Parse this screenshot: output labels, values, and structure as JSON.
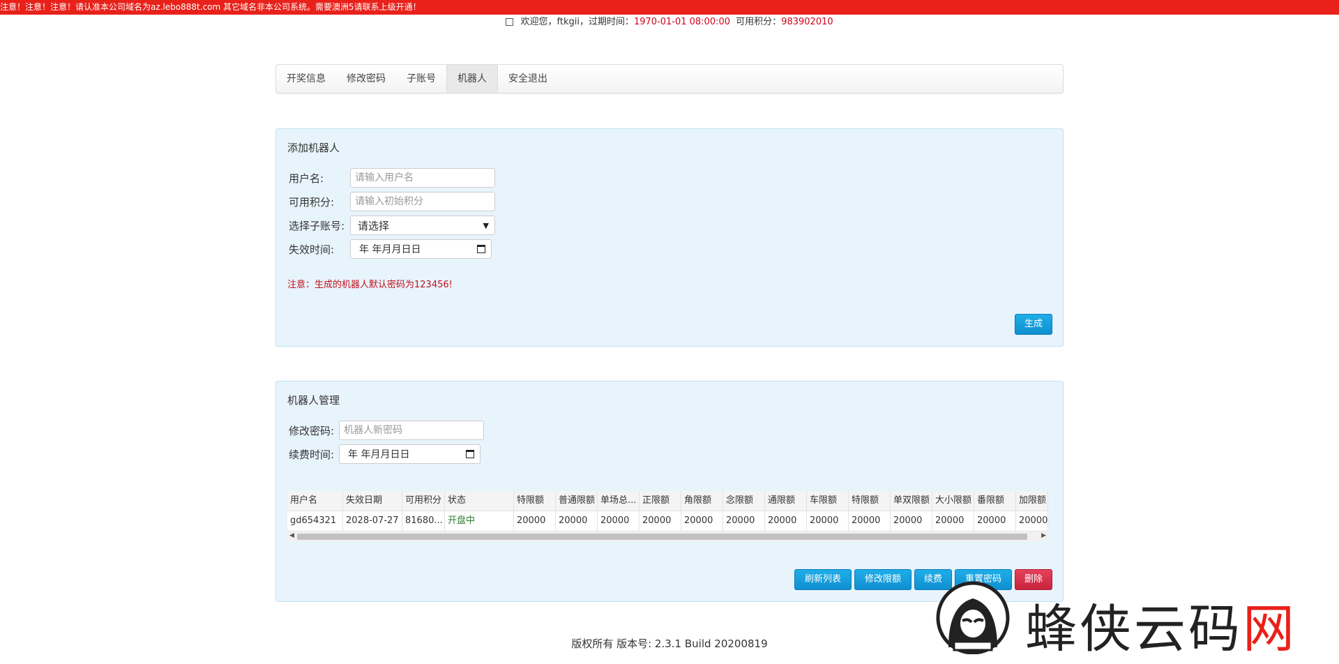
{
  "notice": "注意！注意！注意！请认准本公司域名为az.lebo888t.com 其它域名非本公司系统。需要澳洲5请联系上级开通！",
  "header": {
    "welcome": "欢迎您，ftkgii，过期时间：",
    "expire": "1970-01-01 08:00:00",
    "points_label": "可用积分：",
    "points": "983902010"
  },
  "nav": {
    "tabs": [
      "开奖信息",
      "修改密码",
      "子账号",
      "机器人",
      "安全退出"
    ],
    "active": "机器人"
  },
  "add_panel": {
    "title": "添加机器人",
    "username_label": "用户名:",
    "username_placeholder": "请输入用户名",
    "points_label": "可用积分:",
    "points_placeholder": "请输入初始积分",
    "subaccount_label": "选择子账号:",
    "subaccount_value": "请选择",
    "expire_label": "失效时间:",
    "date_value": "年 年月月日日",
    "warning": "注意：生成的机器人默认密码为123456!",
    "generate": "生成"
  },
  "manage_panel": {
    "title": "机器人管理",
    "password_label": "修改密码:",
    "password_placeholder": "机器人新密码",
    "renew_label": "续费时间:",
    "date_value": "年 年月月日日",
    "table": {
      "columns": [
        "用户名",
        "失效日期",
        "可用积分",
        "状态",
        "特限额",
        "普通限额",
        "单场总...",
        "正限额",
        "角限额",
        "念限额",
        "通限额",
        "车限额",
        "特限额",
        "单双限额",
        "大小限额",
        "番限额",
        "加限额"
      ],
      "rows": [
        [
          "gd654321",
          "2028-07-27",
          "81680...",
          "开盘中",
          "20000",
          "20000",
          "20000",
          "20000",
          "20000",
          "20000",
          "20000",
          "20000",
          "20000",
          "20000",
          "20000",
          "20000",
          "20000"
        ]
      ]
    },
    "buttons": {
      "refresh": "刷新列表",
      "edit_limit": "修改限额",
      "renew": "续费",
      "reset_password": "重置密码",
      "delete": "删除"
    }
  },
  "footer": "版权所有 版本号: 2.3.1 Build 20200819",
  "watermark": {
    "text_main": "蜂侠云码",
    "text_accent": "网"
  },
  "colors": {
    "notice_bg": "#e8211a",
    "accent_blue": "#1ba3e0",
    "danger": "#d0283e",
    "panel_bg": "#e8f4fc"
  }
}
